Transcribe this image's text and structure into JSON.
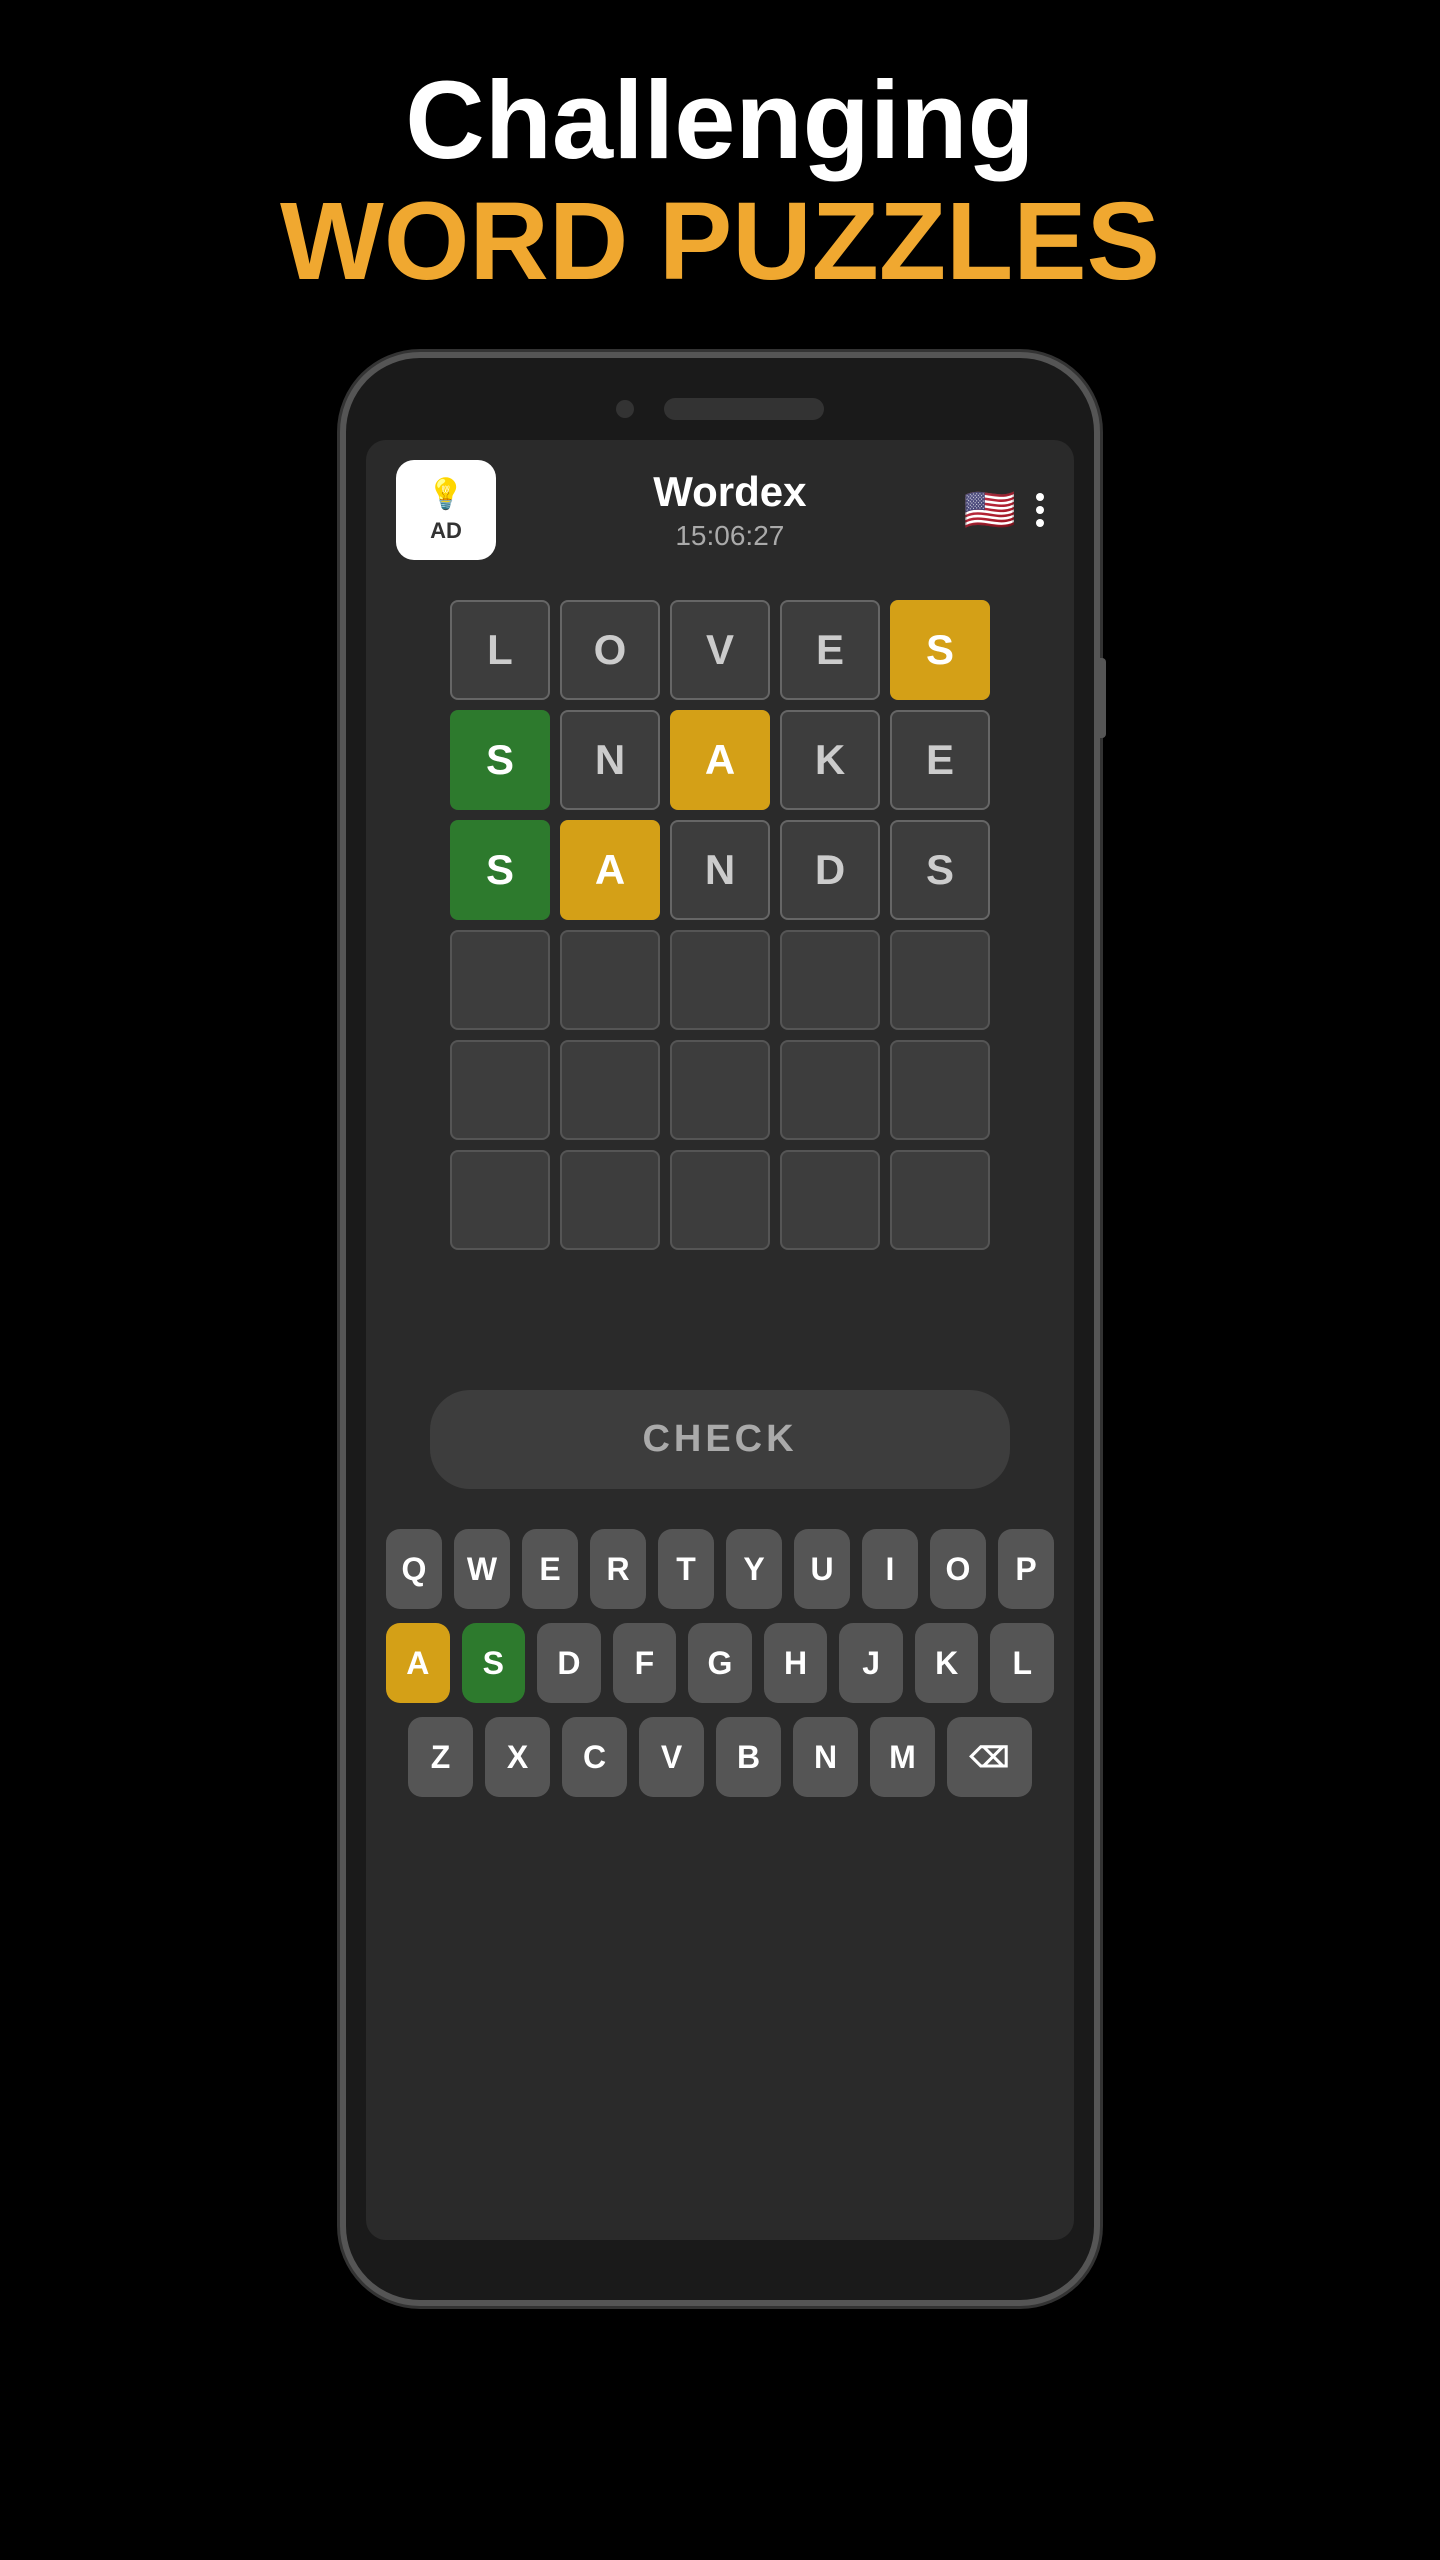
{
  "header": {
    "line1": "Challenging",
    "line2": "WORD PUZZLES"
  },
  "app": {
    "title": "Wordex",
    "timer": "15:06:27",
    "ad_label": "AD",
    "check_label": "CHECK"
  },
  "grid": {
    "rows": [
      [
        {
          "letter": "L",
          "state": "empty"
        },
        {
          "letter": "O",
          "state": "empty"
        },
        {
          "letter": "V",
          "state": "empty"
        },
        {
          "letter": "E",
          "state": "empty"
        },
        {
          "letter": "S",
          "state": "yellow"
        }
      ],
      [
        {
          "letter": "S",
          "state": "green"
        },
        {
          "letter": "N",
          "state": "empty"
        },
        {
          "letter": "A",
          "state": "yellow"
        },
        {
          "letter": "K",
          "state": "empty"
        },
        {
          "letter": "E",
          "state": "empty"
        }
      ],
      [
        {
          "letter": "S",
          "state": "green"
        },
        {
          "letter": "A",
          "state": "yellow"
        },
        {
          "letter": "N",
          "state": "empty"
        },
        {
          "letter": "D",
          "state": "empty"
        },
        {
          "letter": "S",
          "state": "empty"
        }
      ],
      [
        {
          "letter": "",
          "state": "blank"
        },
        {
          "letter": "",
          "state": "blank"
        },
        {
          "letter": "",
          "state": "blank"
        },
        {
          "letter": "",
          "state": "blank"
        },
        {
          "letter": "",
          "state": "blank"
        }
      ],
      [
        {
          "letter": "",
          "state": "blank"
        },
        {
          "letter": "",
          "state": "blank"
        },
        {
          "letter": "",
          "state": "blank"
        },
        {
          "letter": "",
          "state": "blank"
        },
        {
          "letter": "",
          "state": "blank"
        }
      ],
      [
        {
          "letter": "",
          "state": "blank"
        },
        {
          "letter": "",
          "state": "blank"
        },
        {
          "letter": "",
          "state": "blank"
        },
        {
          "letter": "",
          "state": "blank"
        },
        {
          "letter": "",
          "state": "blank"
        }
      ]
    ]
  },
  "keyboard": {
    "row1": [
      "Q",
      "W",
      "E",
      "R",
      "T",
      "Y",
      "U",
      "I",
      "O",
      "P"
    ],
    "row2": [
      "A",
      "S",
      "D",
      "F",
      "G",
      "H",
      "J",
      "K",
      "L"
    ],
    "row3": [
      "Z",
      "X",
      "C",
      "V",
      "B",
      "N",
      "M",
      "⌫"
    ],
    "yellow_keys": [
      "A"
    ],
    "green_keys": [
      "S"
    ]
  }
}
